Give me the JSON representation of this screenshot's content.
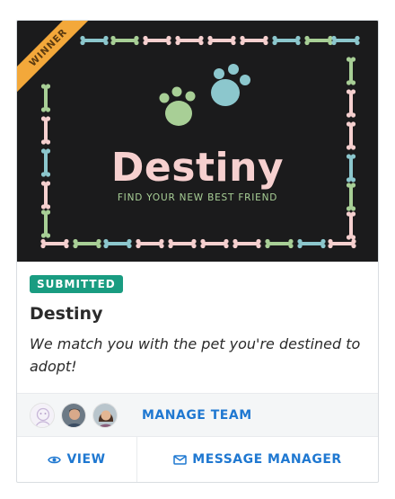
{
  "card": {
    "ribbon": "WINNER",
    "logo_title": "Destiny",
    "logo_tagline": "FIND YOUR NEW BEST FRIEND",
    "status_badge": "SUBMITTED",
    "project_title": "Destiny",
    "description": "We match you with the pet you're destined to adopt!",
    "manage_team_label": "MANAGE TEAM",
    "view_label": "VIEW",
    "message_label": "MESSAGE MANAGER"
  },
  "icons": {
    "view": "eye-icon",
    "message": "envelope-icon",
    "paw_left": "paw-icon",
    "paw_right": "paw-icon"
  },
  "colors": {
    "accent_link": "#1f78d1",
    "badge_bg": "#199c81",
    "ribbon_bg": "#f3a83a",
    "thumb_bg": "#1b1b1c",
    "logo_pink": "#f6d0cf",
    "logo_green": "#a8cf96",
    "logo_blue": "#8cc7cd"
  }
}
